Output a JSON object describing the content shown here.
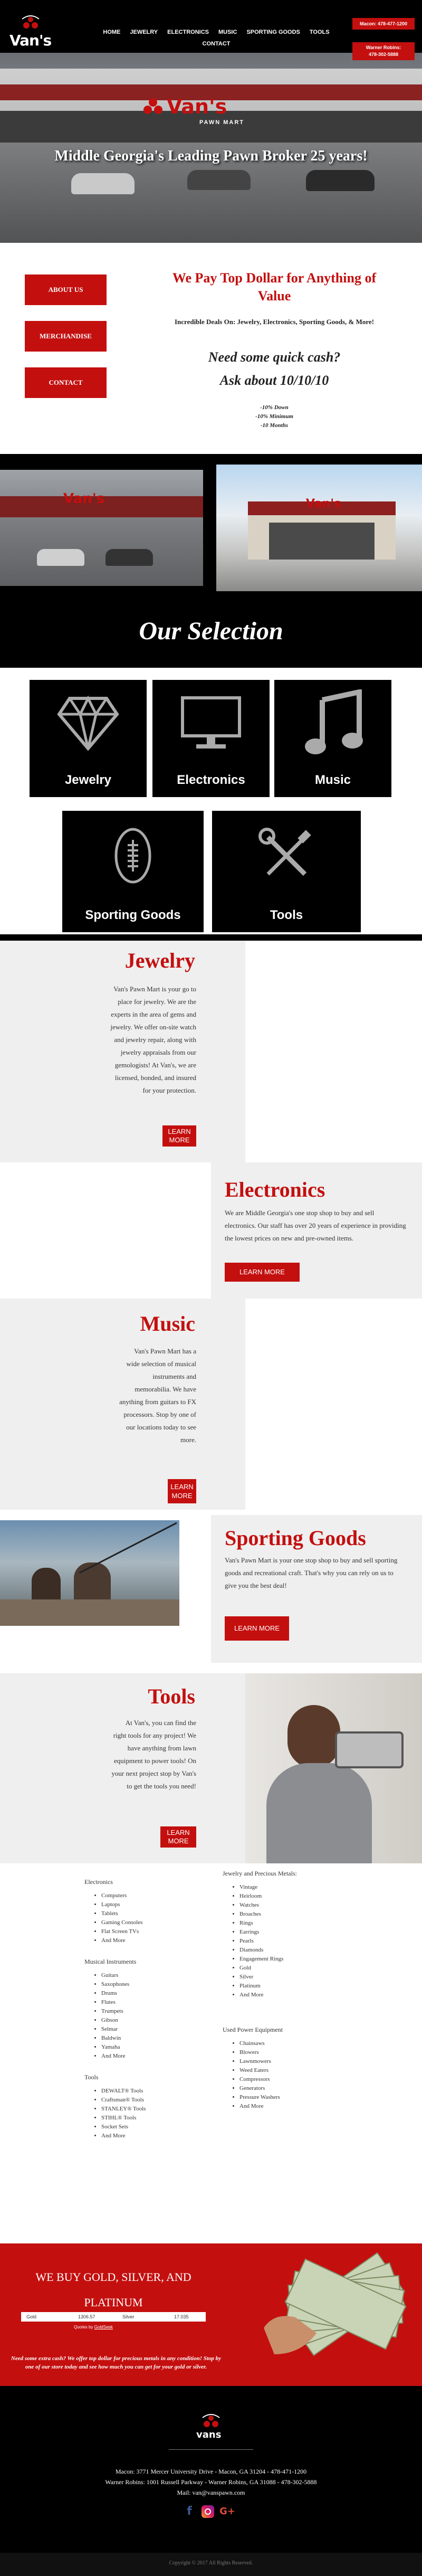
{
  "header": {
    "logo": "Van's",
    "nav": [
      "Home",
      "Jewelry",
      "Electronics",
      "Music",
      "Sporting Goods",
      "Tools",
      "Contact"
    ],
    "macon_phone": "Macon: 478-477-1200",
    "warner_robins": "Warner Robins:",
    "warner_phone": "478-302-5888"
  },
  "hero": {
    "sign": "Van's",
    "sign_sub": "PAWN MART",
    "headline": "Middle Georgia's Leading Pawn Broker 25 years!"
  },
  "intro": {
    "buttons": [
      "About Us",
      "Merchandise",
      "Contact"
    ],
    "title": "We Pay Top Dollar for Anything of Value",
    "deals": "Incredible Deals On: Jewelry, Electronics, Sporting Goods, & More!",
    "cash_q": "Need some quick cash?",
    "ask": "Ask about 10/10/10",
    "terms": [
      "-10% Down",
      "-10% Minimum",
      "-10 Months"
    ]
  },
  "selection": {
    "title": "Our Selection",
    "tiles": [
      {
        "label": "Jewelry",
        "icon": "diamond-icon"
      },
      {
        "label": "Electronics",
        "icon": "monitor-icon"
      },
      {
        "label": "Music",
        "icon": "music-note-icon"
      },
      {
        "label": "Sporting Goods",
        "icon": "football-icon"
      },
      {
        "label": "Tools",
        "icon": "wrench-screwdriver-icon"
      }
    ]
  },
  "sections": {
    "learn_more": "LEARN MORE",
    "jewelry": {
      "title": "Jewelry",
      "text": "Van's Pawn Mart is your go to place for jewelry. We are the experts in the area of gems and jewelry. We offer on-site watch and jewelry repair, along with jewelry appraisals from our gemologists! At Van's, we are licensed, bonded, and insured for your protection."
    },
    "electronics": {
      "title": "Electronics",
      "text": "We are Middle Georgia's one stop shop to buy and sell electronics. Our staff has over 20 years of experience in providing the lowest prices on new and pre-owned items."
    },
    "music": {
      "title": "Music",
      "text": "Van's Pawn Mart has a wide selection of musical instruments and memorabilia. We have anything from guitars to FX processors. Stop by one of our locations today to see more."
    },
    "sporting": {
      "title": "Sporting Goods",
      "text": "Van's Pawn Mart is your one stop shop to buy and sell sporting goods and recreational craft. That's why you can rely on us to give you the best deal!"
    },
    "tools": {
      "title": "Tools",
      "text": "At Van's, you can find the right tools for any project! We have anything from lawn equipment to power tools! On your next project stop by Van's to get the tools you need!"
    }
  },
  "categories": {
    "left": [
      {
        "heading": "Electronics",
        "items": [
          "Computers",
          "Laptops",
          "Tablets",
          "Gaming Consoles",
          "Flat Screen TVs",
          "And More"
        ]
      },
      {
        "heading": "Musical Instruments",
        "items": [
          "Guitars",
          "Saxophones",
          "Drums",
          "Flutes",
          "Trumpets",
          "Gibson",
          "Selmar",
          "Baldwin",
          "Yamaha",
          "And More"
        ]
      },
      {
        "heading": "Tools",
        "items": [
          "DEWALT® Tools",
          "Craftsman® Tools",
          "STANLEY® Tools",
          "STIHL® Tools",
          "Socket Sets",
          "And More"
        ]
      }
    ],
    "right": [
      {
        "heading": "Jewelry and Precious Metals:",
        "items": [
          "Vintage",
          "Heirloom",
          "Watches",
          "Broaches",
          "Rings",
          "Earrings",
          "Pearls",
          "Diamonds",
          "Engagement Rings",
          "Gold",
          "Silver",
          "Platinum",
          "And More"
        ]
      },
      {
        "heading": "Used Power Equipment",
        "items": [
          "Chainsaws",
          "Blowers",
          "Lawnmowers",
          "Weed Eaters",
          "Compressors",
          "Generators",
          "Pressure Washers",
          "And More"
        ]
      }
    ]
  },
  "gold": {
    "title": "WE BUY GOLD, SILVER, AND PLATINUM",
    "gold_label": "Gold",
    "gold_value": "1306.57",
    "silver_label": "Silver",
    "silver_value": "17.035",
    "quotes_by": "Quotes by",
    "quotes_source": "GoldSeek",
    "promo": "Need some extra cash? We offer top dollar for precious metals in any condition! Stop by one of our store today and see how much you can get for your gold or silver."
  },
  "footer": {
    "logo": "vans",
    "macon": "Macon: 3771 Mercer University Drive - Macon, GA 31204 - 478-471-1200",
    "warner": "Warner Robins: 1001 Russell Parkway - Warner Robins, GA 31088 - 478-302-5888",
    "mail": "Mail: van@vanspawn.com",
    "social": [
      "facebook-icon",
      "instagram-icon",
      "google-plus-icon"
    ],
    "copyright": "Copyright © 2017 All Rights Reserved."
  },
  "colors": {
    "brand_red": "#c40f0f",
    "black": "#000000",
    "light_gray": "#efefef"
  }
}
